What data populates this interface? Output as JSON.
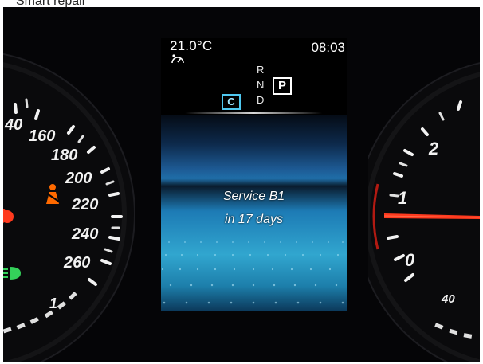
{
  "caption": "Smart repair",
  "display": {
    "temperature": "21.0°C",
    "time": "08:03",
    "gears": [
      "R",
      "N",
      "D"
    ],
    "gear_selected": "P",
    "drive_mode": "C",
    "message_line1": "Service B1",
    "message_line2": "in 17 days"
  },
  "speedometer": {
    "labels": [
      "40",
      "160",
      "180",
      "200",
      "220",
      "240",
      "260",
      "1"
    ]
  },
  "tachometer": {
    "labels": [
      "2",
      "1",
      "0",
      "40"
    ]
  },
  "colors": {
    "mode_accent": "#4fc8f0",
    "needle": "#ff3a1e",
    "screen_blue": "#2f9ccc",
    "warning": "#ff6a00",
    "indicator_green": "#34d15a"
  },
  "icons": [
    "eco-gauge-icon",
    "seatbelt-warning-icon",
    "headlight-icon"
  ]
}
